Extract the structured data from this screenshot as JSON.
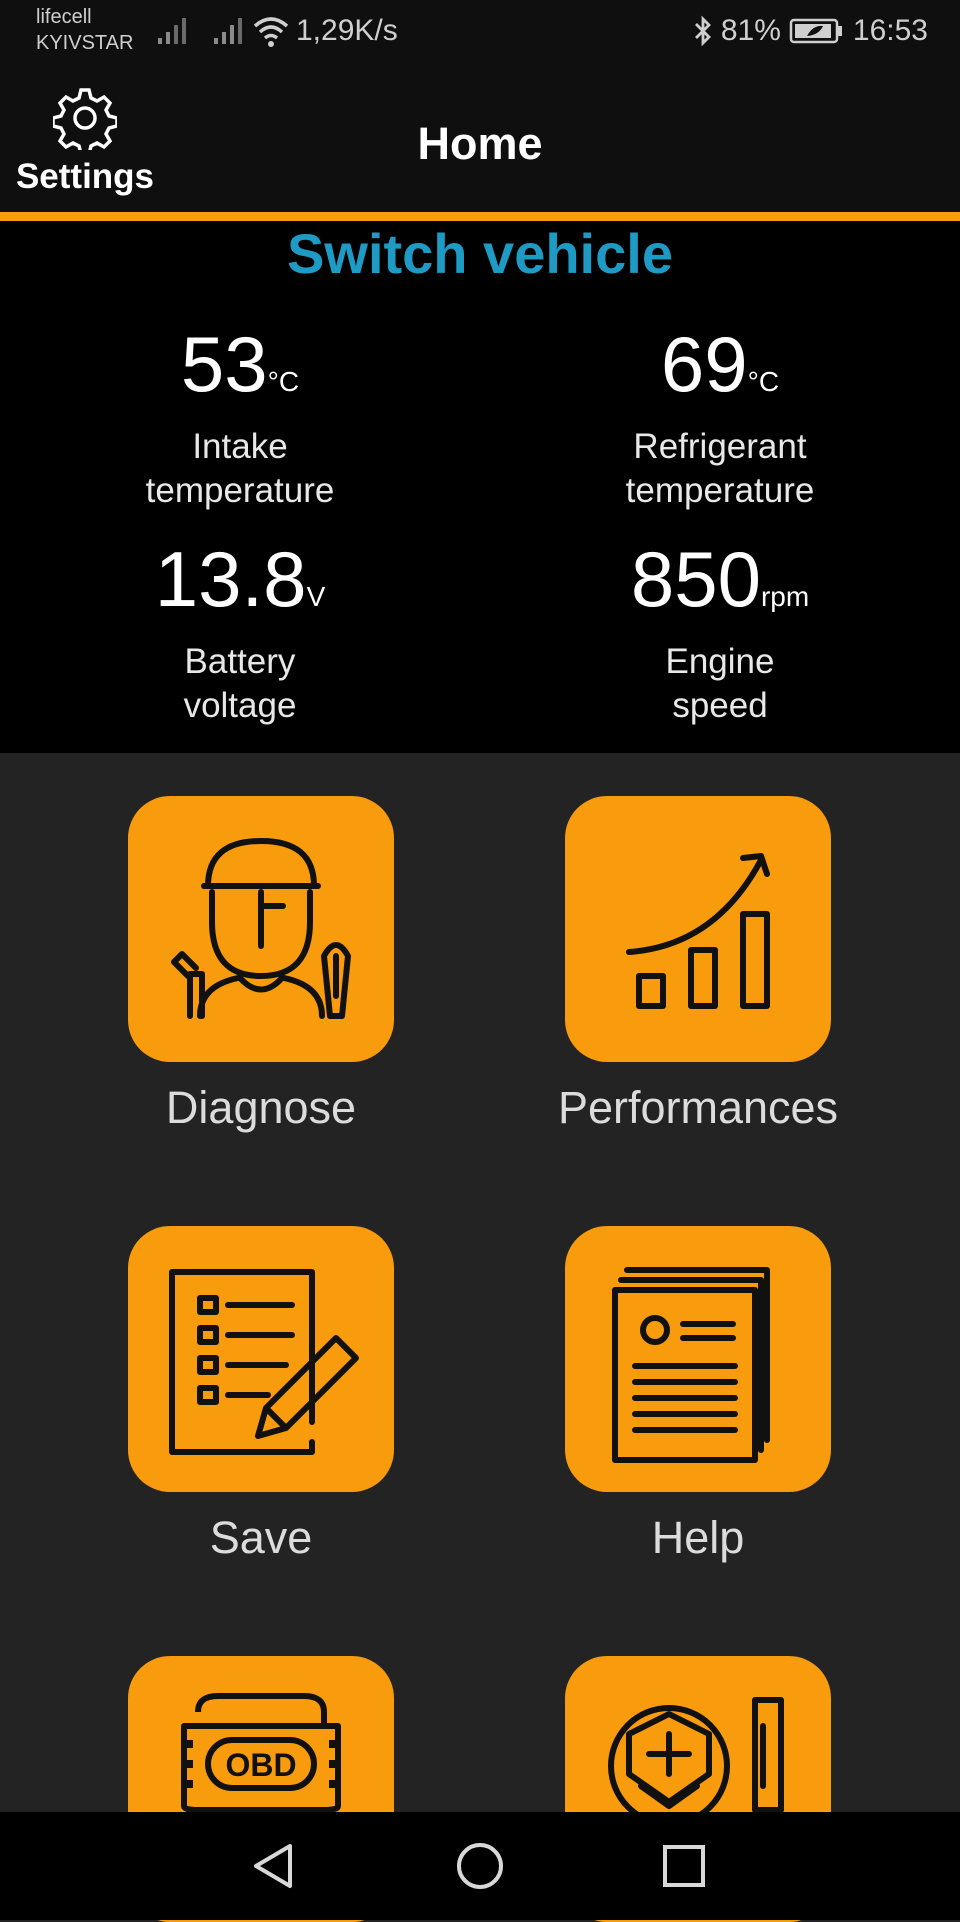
{
  "status_bar": {
    "carrier_1": "lifecell",
    "carrier_2": "KYIVSTAR",
    "net_speed": "1,29K/s",
    "battery": "81%",
    "time": "16:53",
    "icons": [
      "signal-icon",
      "wifi-icon",
      "bluetooth-icon",
      "battery-icon"
    ]
  },
  "header": {
    "settings_label": "Settings",
    "title": "Home"
  },
  "dashboard": {
    "switch_vehicle": "Switch vehicle",
    "metrics": [
      {
        "value": "53",
        "unit": "°C",
        "label": "Intake\ntemperature"
      },
      {
        "value": "69",
        "unit": "°C",
        "label": "Refrigerant\ntemperature"
      },
      {
        "value": "13.8",
        "unit": "V",
        "label": "Battery\nvoltage"
      },
      {
        "value": "850",
        "unit": "rpm",
        "label": "Engine\nspeed"
      }
    ]
  },
  "menu": {
    "items": [
      {
        "label": "Diagnose",
        "icon": "mechanic-icon"
      },
      {
        "label": "Performances",
        "icon": "growth-chart-icon"
      },
      {
        "label": "Save",
        "icon": "checklist-icon"
      },
      {
        "label": "Help",
        "icon": "documents-icon"
      },
      {
        "label": "OBD",
        "icon": "obd-connector-icon"
      },
      {
        "label": "",
        "icon": "shield-tool-icon"
      }
    ]
  },
  "navbar": {
    "buttons": [
      "back-icon",
      "home-icon",
      "recents-icon"
    ]
  },
  "colors": {
    "accent": "#f89b0d",
    "link": "#1e9bc4",
    "background": "#232323",
    "header": "#0f0f10"
  }
}
